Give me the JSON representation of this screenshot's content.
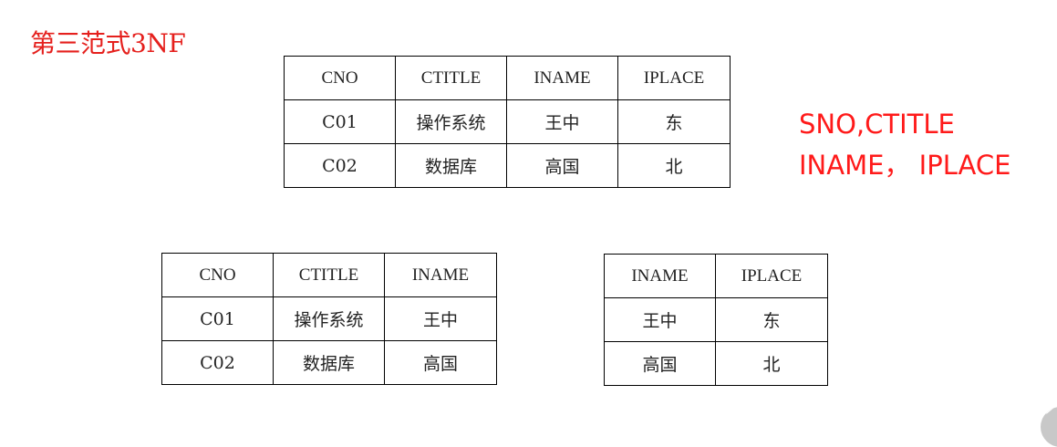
{
  "slide": {
    "title": "第三范式3NF"
  },
  "tables": {
    "main": {
      "headers": [
        "CNO",
        "CTITLE",
        "INAME",
        "IPLACE"
      ],
      "rows": [
        [
          "C01",
          "操作系统",
          "王中",
          "东"
        ],
        [
          "C02",
          "数据库",
          "高国",
          "北"
        ]
      ]
    },
    "course": {
      "headers": [
        "CNO",
        "CTITLE",
        "INAME"
      ],
      "rows": [
        [
          "C01",
          "操作系统",
          "王中"
        ],
        [
          "C02",
          "数据库",
          "高国"
        ]
      ]
    },
    "instructor": {
      "headers": [
        "INAME",
        "IPLACE"
      ],
      "rows": [
        [
          "王中",
          "东"
        ],
        [
          "高国",
          "北"
        ]
      ]
    }
  },
  "note": {
    "line1": "SNO,CTITLE",
    "line2": "INAME， IPLACE"
  },
  "colors": {
    "title": "#e5201d",
    "note": "#ff1a1a",
    "border": "#000000"
  }
}
